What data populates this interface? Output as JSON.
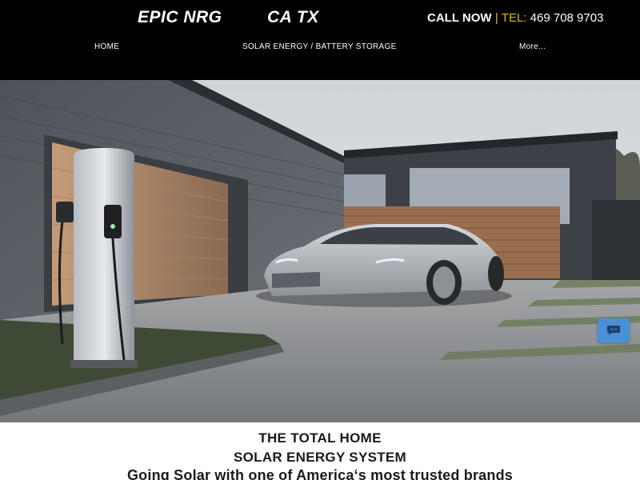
{
  "header": {
    "brand_left": "EPIC NRG",
    "brand_right": "CA  TX",
    "call_now": "CALL NOW",
    "separator": "|",
    "tel_label": "TEL:",
    "tel_number": "469 708 9703"
  },
  "nav": {
    "items": [
      {
        "label": "HOME"
      },
      {
        "label": "SOLAR ENERGY / BATTERY STORAGE"
      },
      {
        "label": "More..."
      }
    ]
  },
  "hero": {
    "chat_icon": "chat-bubble-icon"
  },
  "headline": {
    "line1": "THE TOTAL HOME",
    "line2": "SOLAR ENERGY SYSTEM",
    "line3": "Going Solar with one of America‘s most trusted brands"
  },
  "colors": {
    "header_bg": "#000000",
    "accent": "#e6b800",
    "chat_button": "#4a90d9"
  }
}
